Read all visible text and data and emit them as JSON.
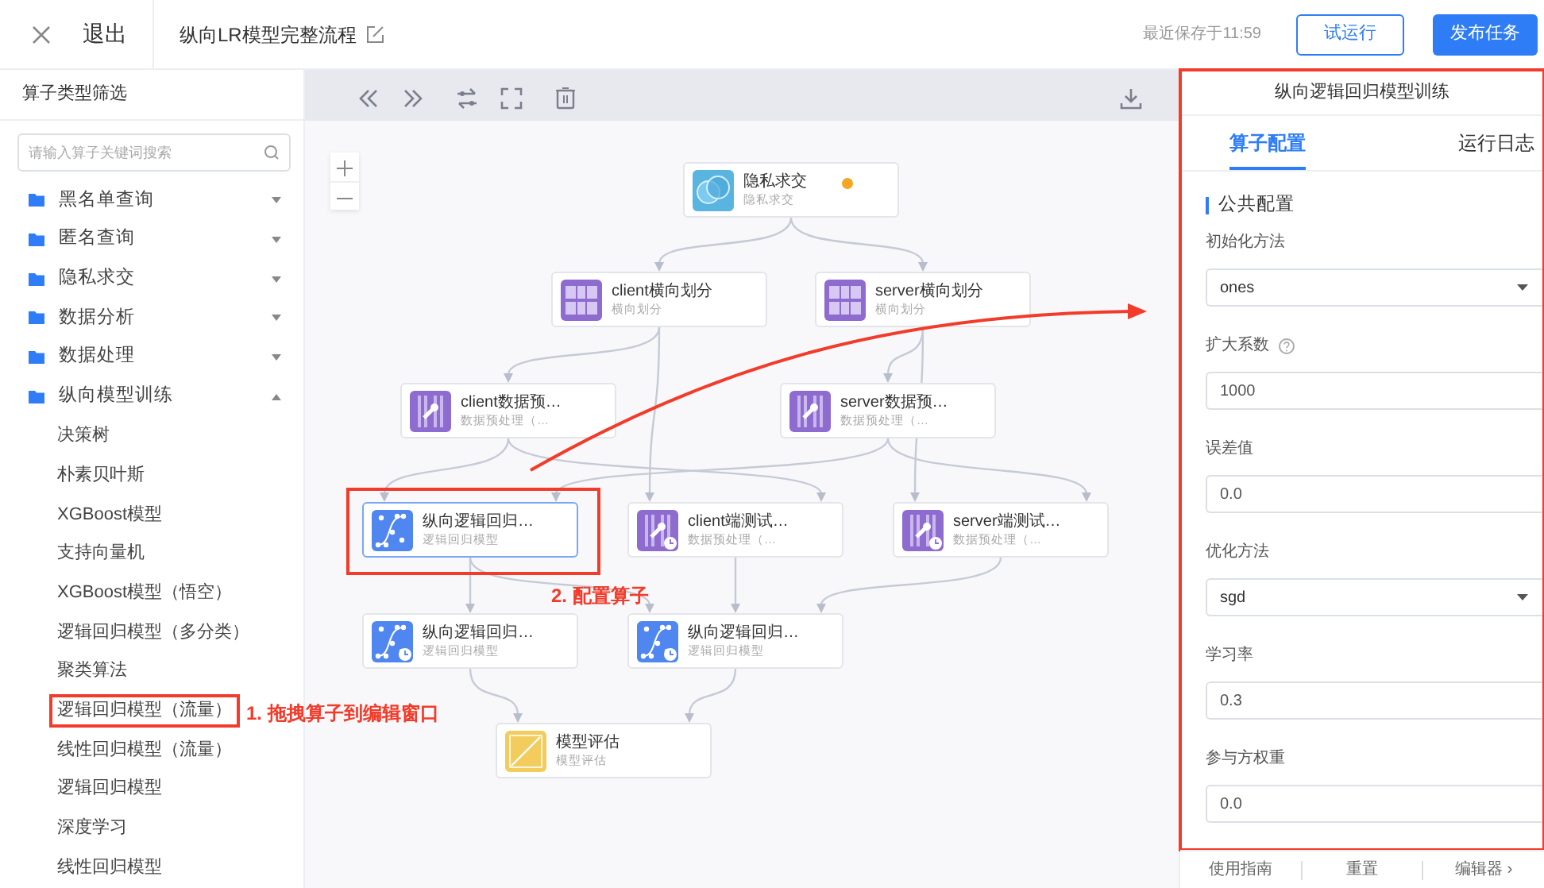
{
  "header": {
    "close_label": "退出",
    "title": "纵向LR模型完整流程",
    "saved": "最近保存于11:59",
    "buttons": [
      {
        "label": "试运行",
        "kind": "outline"
      },
      {
        "label": "发布任务",
        "kind": "primary"
      }
    ]
  },
  "sidebar": {
    "title": "算子类型筛选",
    "search": {
      "placeholder": "请输入算子关键词搜索"
    },
    "items": [
      {
        "label": "黑名单查询",
        "expanded": false
      },
      {
        "label": "匿名查询",
        "expanded": false
      },
      {
        "label": "隐私求交",
        "expanded": false
      },
      {
        "label": "数据分析",
        "expanded": false
      },
      {
        "label": "数据处理",
        "expanded": false
      },
      {
        "label": "纵向模型训练",
        "expanded": true,
        "children": [
          {
            "label": "决策树",
            "highlighted": false
          },
          {
            "label": "朴素贝叶斯",
            "highlighted": false
          },
          {
            "label": "XGBoost模型",
            "highlighted": false
          },
          {
            "label": "支持向量机",
            "highlighted": false
          },
          {
            "label": "XGBoost模型（悟空）",
            "highlighted": false
          },
          {
            "label": "逻辑回归模型（多分类）",
            "highlighted": false
          },
          {
            "label": "聚类算法",
            "highlighted": false
          },
          {
            "label": "逻辑回归模型（流量）",
            "highlighted": true
          },
          {
            "label": "线性回归模型（流量）",
            "highlighted": false
          },
          {
            "label": "逻辑回归模型",
            "highlighted": false
          },
          {
            "label": "深度学习",
            "highlighted": false
          },
          {
            "label": "线性回归模型",
            "highlighted": false
          }
        ]
      }
    ]
  },
  "canvas": {
    "nodes": [
      {
        "title": "隐私求交",
        "subtitle": "隐私求交",
        "kind": "psi",
        "color": "#f5a623",
        "clock": false,
        "selected": false,
        "highlighted": false
      },
      {
        "title": "client横向划分",
        "subtitle": "横向划分",
        "kind": "split",
        "clock": false,
        "selected": false,
        "highlighted": false
      },
      {
        "title": "server横向划分",
        "subtitle": "横向划分",
        "kind": "split",
        "clock": false,
        "selected": false,
        "highlighted": false
      },
      {
        "title": "client数据预…",
        "subtitle": "数据预处理（…",
        "kind": "preprocess",
        "clock": false,
        "selected": false,
        "highlighted": false
      },
      {
        "title": "server数据预…",
        "subtitle": "数据预处理（…",
        "kind": "preprocess",
        "clock": false,
        "selected": false,
        "highlighted": false
      },
      {
        "title": "纵向逻辑回归…",
        "subtitle": "逻辑回归模型",
        "kind": "lr",
        "clock": false,
        "selected": true,
        "highlighted": true
      },
      {
        "title": "client端测试…",
        "subtitle": "数据预处理（…",
        "kind": "preprocess",
        "clock": true,
        "selected": false,
        "highlighted": false
      },
      {
        "title": "server端测试…",
        "subtitle": "数据预处理（…",
        "kind": "preprocess",
        "clock": true,
        "selected": false,
        "highlighted": false
      },
      {
        "title": "纵向逻辑回归…",
        "subtitle": "逻辑回归模型",
        "kind": "lr",
        "clock": true,
        "selected": false,
        "highlighted": false
      },
      {
        "title": "纵向逻辑回归…",
        "subtitle": "逻辑回归模型",
        "kind": "lr",
        "clock": true,
        "selected": false,
        "highlighted": false
      },
      {
        "title": "模型评估",
        "subtitle": "模型评估",
        "kind": "eval",
        "clock": false,
        "selected": false,
        "highlighted": false
      }
    ]
  },
  "annotations": [
    {
      "text": "1. 拖拽算子到编辑窗口"
    },
    {
      "text": "2. 配置算子"
    }
  ],
  "panel": {
    "title": "纵向逻辑回归模型训练",
    "highlighted": true,
    "tabs": [
      {
        "label": "算子配置",
        "selected": true
      },
      {
        "label": "运行日志",
        "selected": false
      }
    ],
    "section": "公共配置",
    "fields": [
      {
        "label": "初始化方法",
        "kind": "select",
        "value": "ones",
        "help": false
      },
      {
        "label": "扩大系数",
        "kind": "input",
        "value": "1000",
        "help": true
      },
      {
        "label": "误差值",
        "kind": "input",
        "value": "0.0",
        "help": false
      },
      {
        "label": "优化方法",
        "kind": "select",
        "value": "sgd",
        "help": false
      },
      {
        "label": "学习率",
        "kind": "input",
        "value": "0.3",
        "help": false
      },
      {
        "label": "参与方权重",
        "kind": "input",
        "value": "0.0",
        "help": false
      }
    ],
    "footer": [
      "使用指南",
      "重置",
      "编辑器 ›"
    ]
  }
}
